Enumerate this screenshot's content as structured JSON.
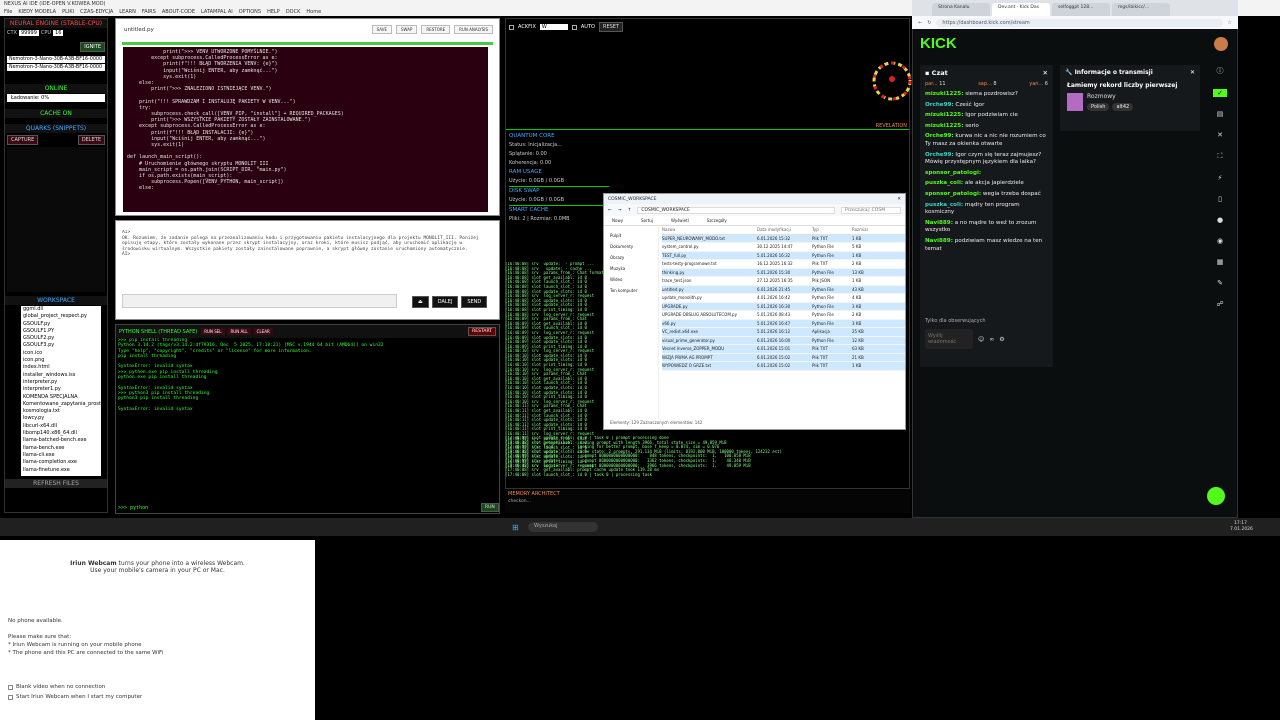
{
  "window": {
    "title": "NEXUS AI IDE (IDE-OPEN V.KOWEA.MOD)",
    "menu": [
      "File",
      "KIEDY MODELA",
      "PLIKI",
      "CZAS-EDYCJA",
      "LEARN",
      "FAIRS",
      "ABOUT-CODE",
      "LATAMPAL AI",
      "OPTIONS",
      "HELP",
      "DOCK",
      "Home"
    ]
  },
  "left": {
    "engine_title": "NEURAL ENGINE (STABLE-CPU)",
    "ctx_label": "CTX",
    "ctx_value": "99999",
    "cpu_label": "CPU",
    "cpu_value": "16",
    "ignite": "IGNITE",
    "models": [
      "Nemotron-3-Nano-30B-A3B-BF16-0000",
      "Nemotron-3-Nano-30B-A3B-BF16-0000"
    ],
    "online": "ONLINE",
    "loading": "Ładowanie: 0%",
    "cache": "CACHE ON",
    "quarks": "QUARKS (SNIPPETS)",
    "capture": "CAPTURE",
    "delete": "DELETE",
    "workspace": "WORKSPACE",
    "files": [
      "ggml.dll",
      "global_project_respect.py",
      "GSOULF.py",
      "GSOULF1.PY",
      "GSOULF2.py",
      "GSOULF3.py",
      "icon.ico",
      "icon.png",
      "index.html",
      "installer_windows.iss",
      "interpreter.py",
      "interpreter1.py",
      "KOMENDA SPECJALNA",
      "Komentowane_zapytania_prostb",
      "kosmologia.txt",
      "lowcy.py",
      "libcurl-x64.dll",
      "libomp140.x86_64.dll",
      "llama-batched-bench.exe",
      "llama-bench.exe",
      "llama-cli.exe",
      "llama-completion.exe",
      "llama-finetune.exe"
    ],
    "refresh": "REFRESH FILES"
  },
  "editor": {
    "filename": "untitled.py",
    "buttons": [
      "SAVE",
      "SWAP",
      "RESTORE",
      "RUN ANALYSIS"
    ],
    "code": "            print(\">>> VENV UTWORZONE POMYŚLNIE.\")\n        except subprocess.CalledProcessError as e:\n            print(f\"!!! BŁĄD TWORZENIA VENV: {e}\")\n            input(\"Wciśnij ENTER, aby zamknąć...\")\n            sys.exit(1)\n    else:\n        print(\">>> ZNALEZIONO ISTNIEJĄCE VENV.\")\n\n    print(\"!!! SPRAWDZAM I INSTALUJĘ PAKIETY W VENV...\")\n    try:\n        subprocess.check_call([VENV_PIP, \"install\"] + REQUIRED_PACKAGES)\n        print(\">>> WSZYSTKIE PAKIETY ZOSTAŁY ZAINSTALOWANE.\")\n    except subprocess.CalledProcessError as e:\n        print(f\"!!! BŁĄD INSTALACJI: {e}\")\n        input(\"Wciśnij ENTER, aby zamknąć...\")\n        sys.exit(1)\n\ndef launch_main_script():\n    # Uruchomienie głównego skryptu MONOLIT_III\n    main_script = os.path.join(SCRIPT_DIR, \"main.py\")\n    if os.path.exists(main_script):\n        subprocess.Popen([VENV_PYTHON, main_script])\n    else:"
  },
  "output": {
    "text": "AI>\nOK. Rozumiem, że zadanie polega na przeanalizowaniu kodu i przygotowaniu pakietu instalacyjnego dla projektu MONOLIT_III. Poniżej opisuję etapy, które zostały wykonane przez skrypt instalacyjny, oraz kroki, które musisz podjąć, aby uruchomić aplikację w środowisku wirtualnym. Wszystkie pakiety zostały zainstalowane poprawnie, a skrypt główny zostanie uruchomiony automatycznie.\nAI>",
    "buttons": [
      "⏏",
      "DALEJ",
      "SEND"
    ]
  },
  "shell": {
    "title": "PYTHON SHELL (THREAD SAFE)",
    "buttons": [
      "RUN SEL",
      "RUN ALL",
      "CLEAR"
    ],
    "restart": "RESTART",
    "text": ">>> pip install threading\nPython 3.14.2 (tags/v3.14.2:df79316, Dec  5 2025, 17:18:21) [MSC v.1944 64 bit (AMD64)] on win32\nType \"help\", \"copyright\", \"credits\" or \"license\" for more information.\npip install threading\n\nSyntaxError: invalid syntax\n>>> python.exe pip install threading\npython.exe pip install threading\n\nSyntaxError: invalid syntax\n>>> python3 pip install threading\npython3 pip install threading\n\nSyntaxError: invalid syntax",
    "prompt": ">>> python",
    "run": "RUN"
  },
  "monitor": {
    "ackfix": "ACKFIX",
    "w": "W",
    "auto": "AUTO",
    "reset": "RESET",
    "revelation": "REVELATION",
    "quantum": "QUANTUM CORE",
    "status": "Status: Inicjalizacja...",
    "splatanie": "Splątanie: 0.00",
    "koherencja": "Koherencja: 0.00",
    "ram": "RAM USAGE",
    "ram_val": "Użycie: 0.0GB / 0.0GB",
    "swap": "DISK SWAP",
    "swap_val": "Użycie: 0.0GB / 0.0GB",
    "smart": "SMART CACHE",
    "smart_val": "Pliki: 2 | Rozmiar: 0.0MB",
    "memory": "MEMORY ARCHITECT",
    "log": "[16:40:08] srv  update:  - prompt ...\n[16:40:08] srv   update: - cache ...\n[16:40:08] srv  params_from_: Chat format\n[16:40:08] slot get_availabl: id 0\n[16:40:08] slot launch_slot_: id 0\n[16:40:08] slot launch_slot_: id 0\n[16:40:08] slot update_slots: id 0\n[16:40:08] srv  log_server_r: request\n[16:40:08] slot update_slots: id 0\n[16:40:08] slot update_slots: id 0\n[16:40:08] slot print_timing: id 0\n[16:40:08] srv  log_server_r: request\n[16:40:09] srv  params_from_: Chat\n[16:40:09] slot get_availabl: id 0\n[16:40:09] slot launch_slot_: id 0\n[16:40:09] srv  log_server_r: request\n[16:40:09] slot update_slots: id 0\n[16:40:09] slot update_slots: id 0\n[16:40:09] slot print_timing: id 0\n[16:40:10] srv  log_server_r: request\n[16:40:10] slot update_slots: id 0\n[16:40:10] slot update_slots: id 0\n[16:40:10] slot print_timing: id 0\n[16:40:10] srv  log_server_r: request\n[16:40:10] srv  params_from_: Chat\n[16:40:10] slot get_availabl: id 0\n[16:40:10] slot launch_slot_: id 0\n[16:40:10] slot update_slots: id 0\n[16:40:10] slot update_slots: id 0\n[16:40:10] slot print_timing: id 0\n[16:40:10] srv  log_server_r: request\n[16:40:11] srv  params_from_: Chat\n[16:40:11] slot get_availabl: id 0\n[16:40:11] slot launch_slot_: id 0\n[16:40:11] slot update_slots: id 0\n[16:40:11] slot update_slots: id 0\n[16:40:11] slot print_timing: id 0\n[16:40:11] srv  log_server_r: request\n[16:40:12] srv  params_from_: Chat\n[16:40:12] slot get_availabl: id 0\n[16:40:12] slot launch_slot_: id 0\n[16:40:12] slot update_slots: id 0\n[16:40:12] slot update_slots: id 0\n[16:40:12] slot print_timing: id 0\n[16:40:12] srv  log_server_r: request",
    "log2": "[17:40:08] slot update_slots: id 0 | task 0 | prompt processing done\n[17:40:08] srv  prompt_save: - saving prompt with length 3966, total state size = 49.859 MiB\n[17:40:08] srv  load:       - looking for better prompt, base f_keep = 0.074, sim = 0.076\n[17:40:08] srv  update:     - cache state: 2 prompts, 291.134 MiB (limits: 8192.000 MiB, 100000 tokens, 124232 est)\n[17:40:08] srv  update:       - prompt 0000000000000000:    848 tokens, checkpoints:  1,   100.058 MiB\n[17:40:08] srv  update:       - prompt 0000000000000000:   3362 tokens, checkpoints:  1,    48.340 MiB\n[17:40:08] srv  update:       - prompt 0000000000000000:   3966 tokens, checkpoints:  1,    49.859 MiB\n[17:40:08] srv  get_availabl: prompt cache update took 119.28 ms\n[17:40:08] slot launch_slot_: id 0 | task 0 | processing task",
    "status2": "checkon..."
  },
  "explorer": {
    "title": "COSMIC_WORKSPACE",
    "path": "COSMIC_WORKSPACE",
    "search": "Przeszukaj: COSM",
    "toolbar": [
      "Nowy",
      "Sortuj",
      "Wyświetl",
      "Szczegóły"
    ],
    "cols": [
      "Nazwa",
      "Data modyfikacji",
      "Typ",
      "Rozmiar"
    ],
    "side": [
      "Pulpit",
      "Dokumenty",
      "Obrazy",
      "Muzyka",
      "Wideo",
      "Ten komputer"
    ],
    "rows": [
      {
        "name": "SUPER_NEUROWANY_MODO.txt",
        "date": "6.01.2026 15:32",
        "type": "Plik TXT",
        "size": "1 KB"
      },
      {
        "name": "system_control.py",
        "date": "30.12.2025 14:47",
        "type": "Python File",
        "size": "5 KB"
      },
      {
        "name": "TEST_full.py",
        "date": "5.01.2026 16:32",
        "type": "Python File",
        "size": "1 KB"
      },
      {
        "name": "tests-testy-programowe.txt",
        "date": "16.12.2025 16:32",
        "type": "Plik TXT",
        "size": "2 KB"
      },
      {
        "name": "thinking.py",
        "date": "5.01.2026 15:30",
        "type": "Python File",
        "size": "13 KB"
      },
      {
        "name": "trace_test.json",
        "date": "27.12.2025 16:35",
        "type": "Plik JSON",
        "size": "1 KB"
      },
      {
        "name": "untitled.py",
        "date": "6.01.2026 21:45",
        "type": "Python File",
        "size": "43 KB"
      },
      {
        "name": "update_monolith.py",
        "date": "4.01.2026 16:42",
        "type": "Python File",
        "size": "4 KB"
      },
      {
        "name": "UPGRADE.py",
        "date": "5.01.2026 16:30",
        "type": "Python File",
        "size": "3 KB"
      },
      {
        "name": "UPGRADE OBSLUG ABSOLUTECOM.py",
        "date": "5.01.2026 08:43",
        "type": "Python File",
        "size": "2 KB"
      },
      {
        "name": "v66.py",
        "date": "5.01.2026 16:47",
        "type": "Python File",
        "size": "3 KB"
      },
      {
        "name": "VC_redist.x64.exe",
        "date": "5.01.2026 16:12",
        "type": "Aplikacja",
        "size": "25 KB"
      },
      {
        "name": "visual_prime_generator.py",
        "date": "6.01.2026 16:00",
        "type": "Python File",
        "size": "12 KB"
      },
      {
        "name": "Vesnet Inverse_ZOPPER_MODU",
        "date": "6.01.2026 15:01",
        "type": "Plik TXT",
        "size": "63 KB"
      },
      {
        "name": "WIZJA PRIMA AG PROMPT",
        "date": "6.01.2026 15:02",
        "type": "Plik TXT",
        "size": "21 KB"
      },
      {
        "name": "WYPOWIEDZ O GRZE.txt",
        "date": "6.01.2026 15:02",
        "type": "Plik TXT",
        "size": "1 KB"
      }
    ],
    "status": "Elementy: 129    Zaznaczonych elementów: 142"
  },
  "browser": {
    "tabs": [
      "Strona Kanału",
      "Dev.ant · Kick Das",
      "selfoggpt 128...",
      "mgs/ibikicc/..."
    ],
    "url": "https://dashboard.kick.com/stream",
    "logo": "KICK",
    "chat_title": "Czat",
    "viewers": [
      {
        "name": "par...",
        "n": "11"
      },
      {
        "name": "sap...",
        "n": "8"
      },
      {
        "name": "yan...",
        "n": "6"
      }
    ],
    "messages": [
      {
        "user": "mizuki1225:",
        "text": "siema pozdrowisz?"
      },
      {
        "user": "Orche99:",
        "text": "Cześć Igor"
      },
      {
        "user": "mizuki1225:",
        "text": "Igor podziwiam cie"
      },
      {
        "user": "mizuki1225:",
        "text": "serio"
      },
      {
        "user": "Orche99:",
        "text": "kurwa nic a nic nie rozumiem co Ty masz za okienka otwarte"
      },
      {
        "user": "Orche99:",
        "text": "Igor czym się teraz zajmujesz? Mówię przystępnym językiem dla laika?"
      },
      {
        "user": "sponsor_patologi:",
        "text": ""
      },
      {
        "user": "puszka_coli:",
        "text": "ale akcja japierdziele"
      },
      {
        "user": "sponsor_patologi:",
        "text": "wegia trzeba dospać"
      },
      {
        "user": "puszka_coli:",
        "text": "mądry ten program kosmiczny"
      },
      {
        "user": "Navi889:",
        "text": "a no mądre to weź to zrozum wszystko"
      },
      {
        "user": "Navi889:",
        "text": "podziwiam masz wiedze na ten temat"
      }
    ],
    "followers_only": "Tylko dla obserwujących",
    "send_placeholder": "Wyślij wiadomość",
    "info_title": "Informacje o transmisji",
    "stream_title": "Łamiemy rekord liczby pierwszej",
    "category": "Rozmowy",
    "tags": [
      "Polish",
      "alt42"
    ]
  },
  "taskbar": {
    "search": "Wyszukaj",
    "time": "17:17",
    "date": "7.01.2026"
  },
  "webcam": {
    "heading_b": "Iriun Webcam",
    "heading": "turns your phone into a wireless Webcam.",
    "sub": "Use your mobile's camera in your PC or Mac.",
    "nophone": "No phone available.",
    "sure": "Please make sure that:",
    "b1": "* Iriun Webcam is running on your mobile phone",
    "b2": "* The phone and this PC are connected to the same WiFi",
    "c1": "Blank video when no connection",
    "c2": "Start Iriun Webcam when I start my computer"
  },
  "colors": {
    "kick_green": "#53fc18",
    "code_bg": "#2a0010",
    "terminal_green": "#33ff33"
  }
}
